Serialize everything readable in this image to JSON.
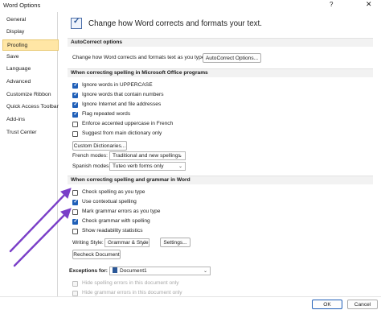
{
  "window": {
    "title": "Word Options",
    "help_glyph": "?",
    "close_glyph": "✕"
  },
  "sidebar": {
    "items": [
      {
        "label": "General"
      },
      {
        "label": "Display"
      },
      {
        "label": "Proofing",
        "active": true
      },
      {
        "label": "Save"
      },
      {
        "label": "Language"
      },
      {
        "label": "Advanced"
      },
      {
        "label": "Customize Ribbon"
      },
      {
        "label": "Quick Access Toolbar"
      },
      {
        "label": "Add-ins"
      },
      {
        "label": "Trust Center"
      }
    ]
  },
  "header": {
    "title": "Change how Word corrects and formats your text.",
    "icon": "proofing-check-icon"
  },
  "autocorrect": {
    "section_title": "AutoCorrect options",
    "description": "Change how Word corrects and formats text as you type:",
    "button_label": "AutoCorrect Options..."
  },
  "office_spelling": {
    "section_title": "When correcting spelling in Microsoft Office programs",
    "options": [
      {
        "label": "Ignore words in UPPERCASE",
        "checked": true
      },
      {
        "label": "Ignore words that contain numbers",
        "checked": true
      },
      {
        "label": "Ignore Internet and file addresses",
        "checked": true
      },
      {
        "label": "Flag repeated words",
        "checked": true
      },
      {
        "label": "Enforce accented uppercase in French",
        "checked": false
      },
      {
        "label": "Suggest from main dictionary only",
        "checked": false
      }
    ],
    "custom_dict_button": "Custom Dictionaries...",
    "french_modes_label": "French modes:",
    "french_modes_value": "Traditional and new spellings",
    "spanish_modes_label": "Spanish modes:",
    "spanish_modes_value": "Tuteo verb forms only"
  },
  "word_spelling": {
    "section_title": "When correcting spelling and grammar in Word",
    "options": [
      {
        "label": "Check spelling as you type",
        "checked": false
      },
      {
        "label": "Use contextual spelling",
        "checked": true
      },
      {
        "label": "Mark grammar errors as you type",
        "checked": false
      },
      {
        "label": "Check grammar with spelling",
        "checked": true
      },
      {
        "label": "Show readability statistics",
        "checked": false
      }
    ],
    "writing_style_label": "Writing Style:",
    "writing_style_value": "Grammar & Style",
    "settings_button": "Settings...",
    "recheck_button": "Recheck Document"
  },
  "exceptions": {
    "label": "Exceptions for:",
    "document_value": "Document1",
    "options": [
      {
        "label": "Hide spelling errors in this document only",
        "checked": false,
        "disabled": true
      },
      {
        "label": "Hide grammar errors in this document only",
        "checked": false,
        "disabled": true
      }
    ]
  },
  "footer": {
    "ok_label": "OK",
    "cancel_label": "Cancel"
  },
  "colors": {
    "accent": "#1f5fb8",
    "selected_nav": "#ffe6a5",
    "arrow": "#7a3fc8"
  }
}
